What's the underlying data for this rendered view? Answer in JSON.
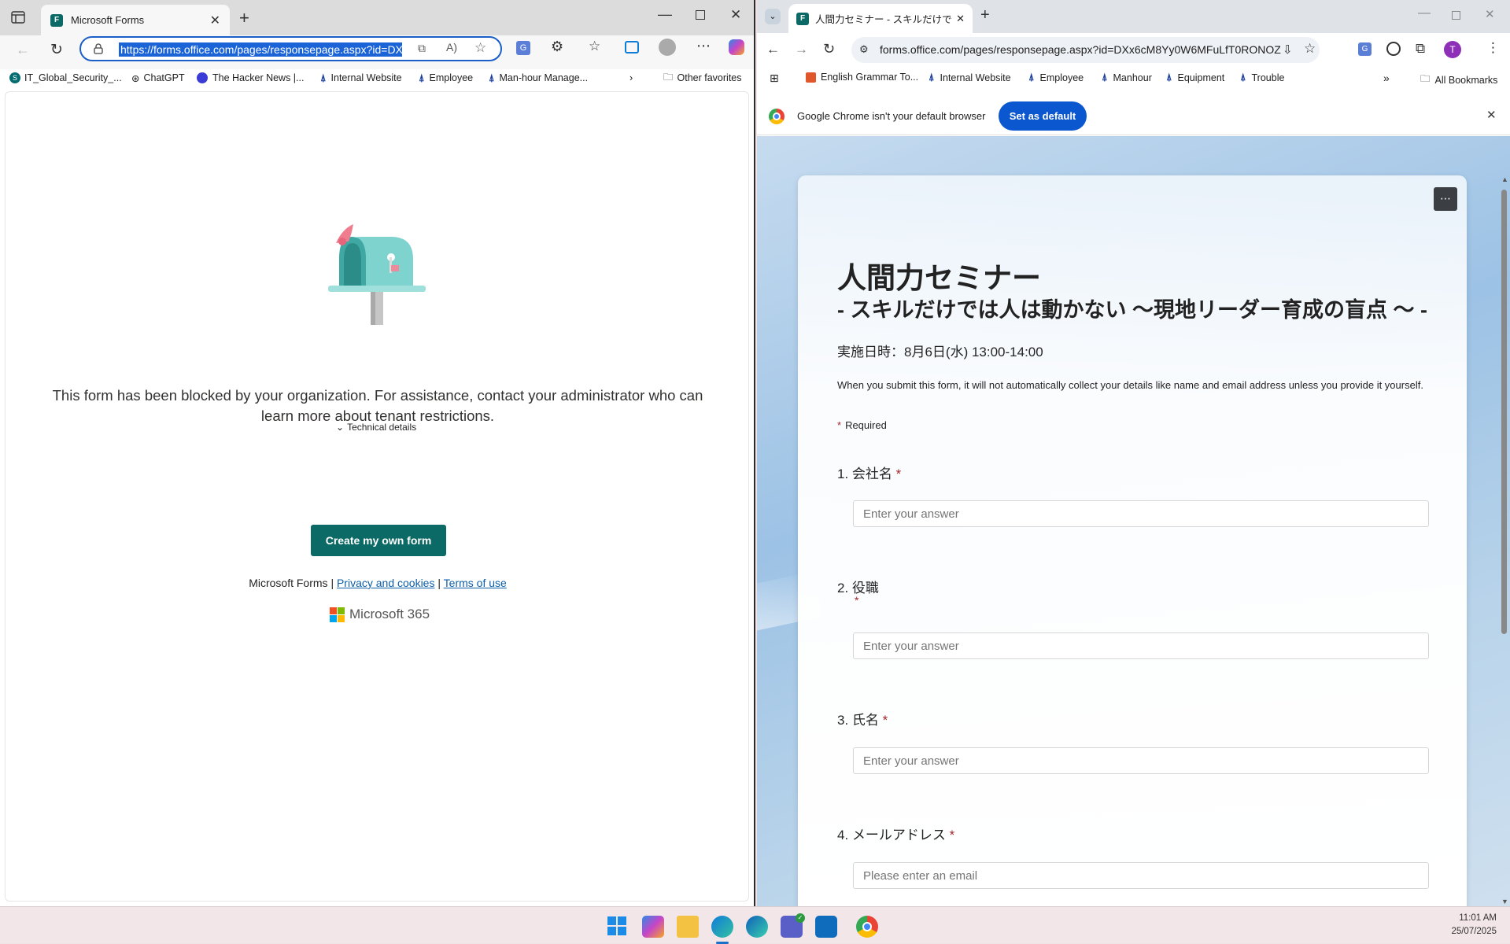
{
  "edge": {
    "tab_title": "Microsoft Forms",
    "url": "https://forms.office.com/pages/responsepage.aspx?id=DX",
    "bookmarks": [
      "IT_Global_Security_...",
      "ChatGPT",
      "The Hacker News |...",
      "Internal Website",
      "Employee",
      "Man-hour Manage..."
    ],
    "other_favorites": "Other favorites",
    "blocked_message_line1": "This form has been blocked by your organization. For assistance, contact your administrator who can",
    "blocked_message_line2": "learn more about tenant restrictions.",
    "technical_details": "Technical details",
    "create_button": "Create my own form",
    "footer": {
      "brand": "Microsoft Forms",
      "sep": "|",
      "privacy": "Privacy and cookies",
      "terms": "Terms of use"
    },
    "ms365": "Microsoft 365"
  },
  "chrome": {
    "tab_title": "人間力セミナー - スキルだけでは人は動かない",
    "url": "forms.office.com/pages/responsepage.aspx?id=DXx6cM8Yy0W6MFuLfT0RONOZI...",
    "bookmarks": [
      "English Grammar To...",
      "Internal Website",
      "Employee",
      "Manhour",
      "Equipment",
      "Trouble"
    ],
    "all_bookmarks": "All Bookmarks",
    "profile_initial": "T",
    "infobar_text": "Google Chrome isn't your default browser",
    "set_default_button": "Set as default",
    "form": {
      "title": "人間力セミナー",
      "subtitle": "- スキルだけでは人は動かない 〜現地リーダー育成の盲点 〜 -",
      "date": "実施日時：8月6日(水) 13:00-14:00",
      "notice": "When you submit this form, it will not automatically collect your details like name and email address unless you provide it yourself.",
      "required_label": "Required",
      "questions": [
        {
          "number": "1.",
          "label": "会社名",
          "placeholder": "Enter your answer"
        },
        {
          "number": "2.",
          "label": "役職",
          "placeholder": "Enter your answer"
        },
        {
          "number": "3.",
          "label": "氏名",
          "placeholder": "Enter your answer"
        },
        {
          "number": "4.",
          "label": "メールアドレス",
          "placeholder": "Please enter an email"
        }
      ]
    }
  },
  "taskbar": {
    "time": "11:01 AM",
    "date": "25/07/2025"
  },
  "colors": {
    "teal": "#0b6a66",
    "chrome_blue": "#0b57d0",
    "required_red": "#a4262c"
  }
}
